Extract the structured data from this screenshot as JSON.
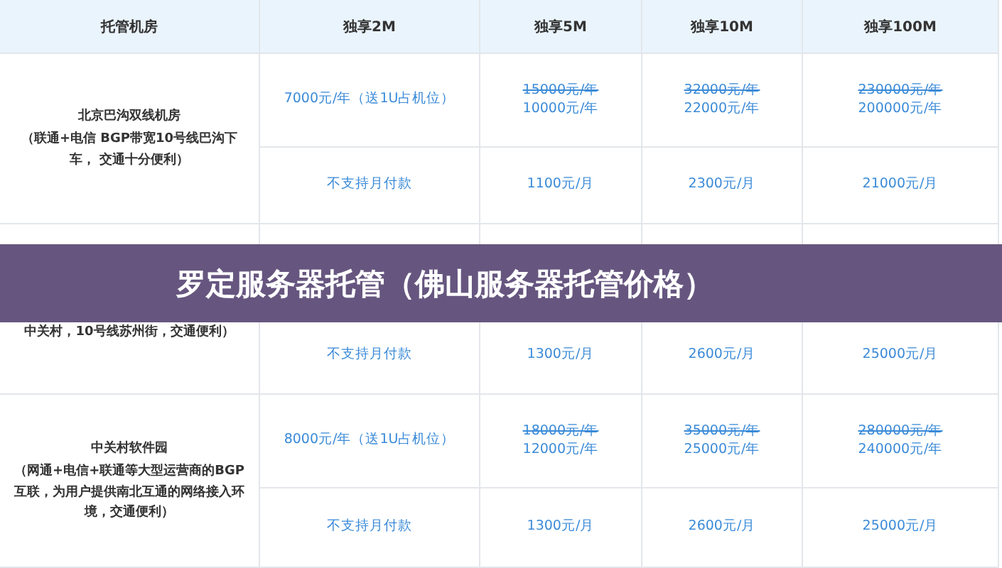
{
  "table": {
    "columns": [
      "托管机房",
      "独享2M",
      "独享5M",
      "独享10M",
      "独享100M"
    ],
    "rows": [
      {
        "name": "北京巴沟双线机房",
        "description": "（联通+电信 BGP带宽10号线巴沟下车， 交通十分便利）",
        "annual": [
          [
            {
              "text": "7000元/年（送1U占机位）",
              "struck": false
            }
          ],
          [
            {
              "text": "15000元/年",
              "struck": true
            },
            {
              "text": "10000元/年",
              "struck": false
            }
          ],
          [
            {
              "text": "32000元/年",
              "struck": true
            },
            {
              "text": "22000元/年",
              "struck": false
            }
          ],
          [
            {
              "text": "230000元/年",
              "struck": true
            },
            {
              "text": "200000元/年",
              "struck": false
            }
          ]
        ],
        "monthly": [
          "不支持月付款",
          "1100元/月",
          "2300元/月",
          "21000元/月"
        ]
      },
      {
        "description": "中关村，10号线苏州街，交通便利）",
        "monthly": [
          "不支持月付款",
          "1300元/月",
          "2600元/月",
          "25000元/月"
        ]
      },
      {
        "name": "中关村软件园",
        "description": "（网通+电信+联通等大型运营商的BGP互联，为用户提供南北互通的网络接入环境，交通便利）",
        "annual": [
          [
            {
              "text": "8000元/年（送1U占机位）",
              "struck": false
            }
          ],
          [
            {
              "text": "18000元/年",
              "struck": true
            },
            {
              "text": "12000元/年",
              "struck": false
            }
          ],
          [
            {
              "text": "35000元/年",
              "struck": true
            },
            {
              "text": "25000元/年",
              "struck": false
            }
          ],
          [
            {
              "text": "280000元/年",
              "struck": true
            },
            {
              "text": "240000元/年",
              "struck": false
            }
          ]
        ],
        "monthly": [
          "不支持月付款",
          "1300元/月",
          "2600元/月",
          "25000元/月"
        ]
      }
    ]
  },
  "banner": {
    "title": "罗定服务器托管（佛山服务器托管价格）"
  }
}
